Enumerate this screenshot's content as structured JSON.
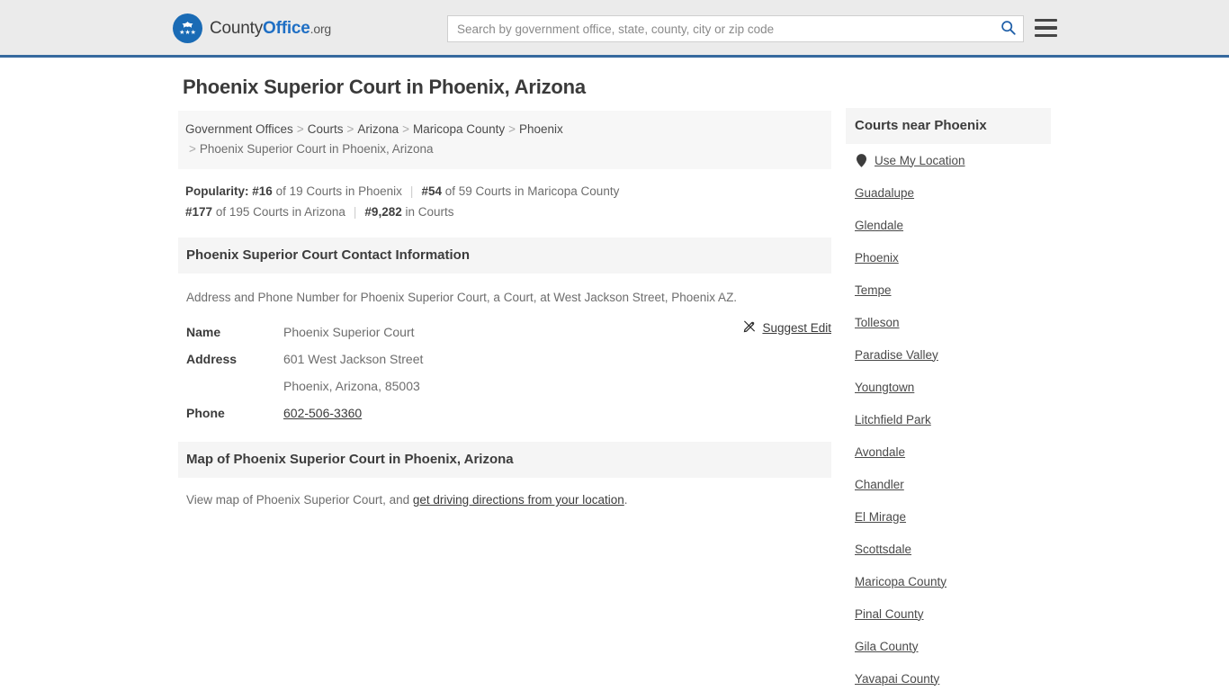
{
  "header": {
    "logo": {
      "part1": "County",
      "part2": "Office",
      "part3": ".org",
      "icon": "eagle-seal-icon"
    },
    "search": {
      "placeholder": "Search by government office, state, county, city or zip code",
      "value": "",
      "icon": "search-icon"
    },
    "menu_icon": "hamburger-menu-icon",
    "accent_color": "#36699e",
    "background_color": "#ebebeb"
  },
  "main": {
    "page_title": "Phoenix Superior Court in Phoenix, Arizona",
    "breadcrumb": {
      "items": [
        "Government Offices",
        "Courts",
        "Arizona",
        "Maricopa County",
        "Phoenix"
      ],
      "current": "Phoenix Superior Court in Phoenix, Arizona",
      "separator": ">"
    },
    "popularity": {
      "label": "Popularity:",
      "items": [
        {
          "rank": "#16",
          "text": "of 19 Courts in Phoenix"
        },
        {
          "rank": "#54",
          "text": "of 59 Courts in Maricopa County"
        },
        {
          "rank": "#177",
          "text": "of 195 Courts in Arizona"
        },
        {
          "rank": "#9,282",
          "text": "in Courts"
        }
      ]
    },
    "contact_section": {
      "heading": "Phoenix Superior Court Contact Information",
      "description": "Address and Phone Number for Phoenix Superior Court, a Court, at West Jackson Street, Phoenix AZ.",
      "suggest_edit": {
        "label": "Suggest Edit",
        "icon": "edit-pencil-icon"
      },
      "rows": [
        {
          "key": "Name",
          "value": "Phoenix Superior Court",
          "link": false
        },
        {
          "key": "Address",
          "value": "601 West Jackson Street",
          "link": false
        },
        {
          "key": "",
          "value": "Phoenix, Arizona, 85003",
          "link": false
        },
        {
          "key": "Phone",
          "value": "602-506-3360",
          "link": true
        }
      ]
    },
    "map_section": {
      "heading": "Map of Phoenix Superior Court in Phoenix, Arizona",
      "description_prefix": "View map of Phoenix Superior Court, and ",
      "description_link": "get driving directions from your location",
      "description_suffix": "."
    }
  },
  "sidebar": {
    "heading": "Courts near Phoenix",
    "use_my_location": {
      "label": "Use My Location",
      "icon": "map-pin-icon"
    },
    "items": [
      "Guadalupe",
      "Glendale",
      "Phoenix",
      "Tempe",
      "Tolleson",
      "Paradise Valley",
      "Youngtown",
      "Litchfield Park",
      "Avondale",
      "Chandler",
      "El Mirage",
      "Scottsdale",
      "Maricopa County",
      "Pinal County",
      "Gila County",
      "Yavapai County"
    ]
  }
}
